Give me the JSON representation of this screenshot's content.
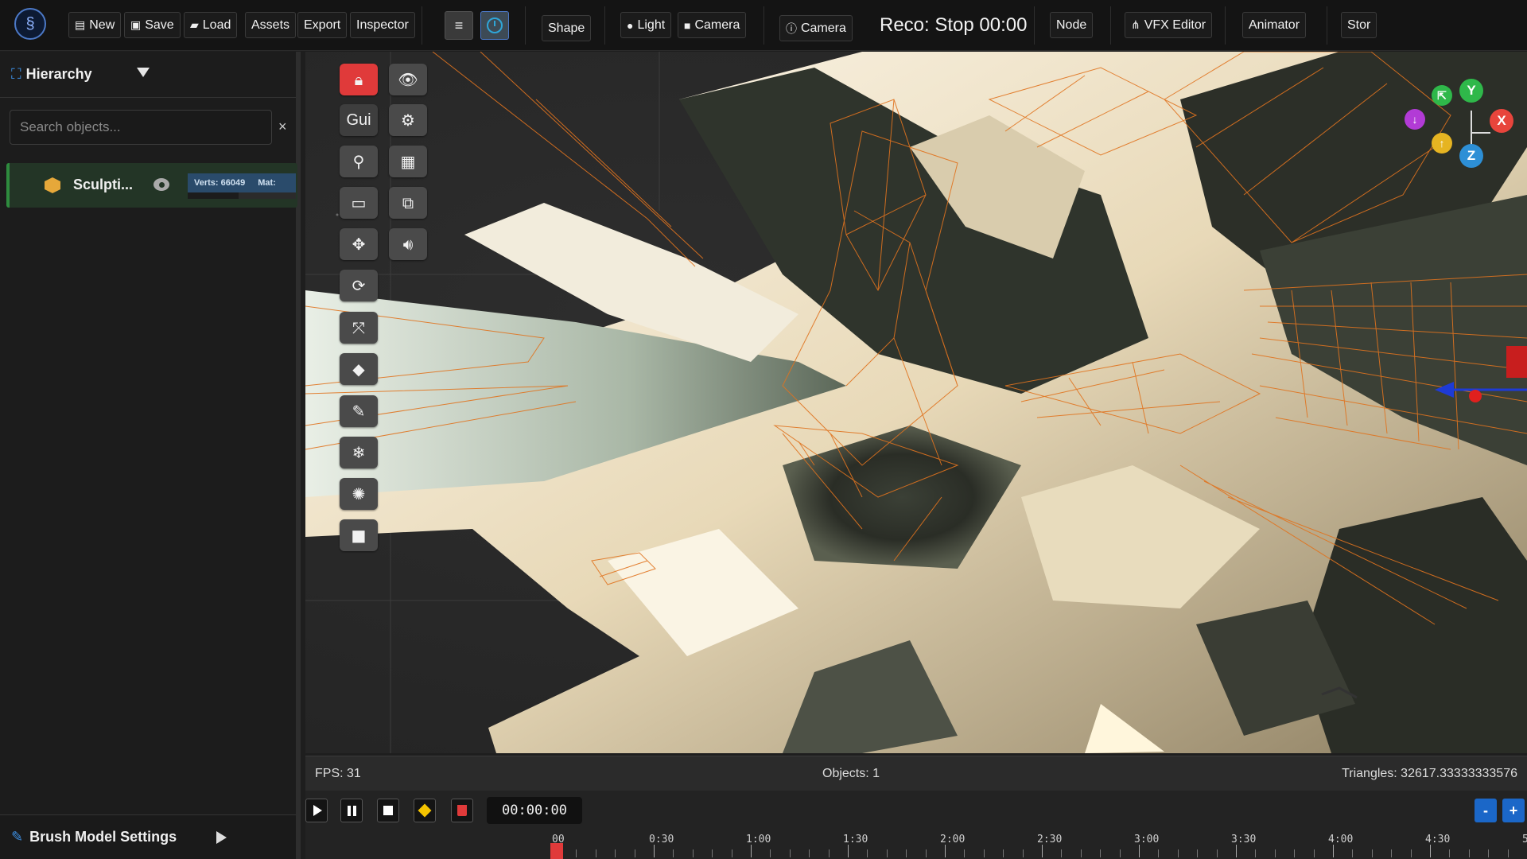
{
  "topbar": {
    "new_label": "New",
    "save_label": "Save",
    "load_label": "Load",
    "assets_label": "Assets",
    "export_label": "Export",
    "inspector_label": "Inspector",
    "shape_label": "Shape",
    "light_label": "Light",
    "camera_label": "Camera",
    "camera2_label": "Camera",
    "reco_status": "Reco: Stop 00:00",
    "node_label": "Node",
    "vfx_label": "VFX Editor",
    "animator_label": "Animator",
    "store_label": "Stor"
  },
  "hierarchy": {
    "title": "Hierarchy",
    "search_placeholder": "Search objects...",
    "clear_glyph": "×",
    "objects": [
      {
        "name": "Sculpti...",
        "verts": "Verts: 66049",
        "mat": "Mat:"
      }
    ]
  },
  "brush": {
    "title": "Brush Model Settings"
  },
  "toolbar": {
    "gui_label": "Gui"
  },
  "gizmo": {
    "y_label": "Y",
    "x_label": "X",
    "z_label": "Z",
    "colors": {
      "y": "#2fb84a",
      "x": "#e8453c",
      "z": "#2d8fd6",
      "extra_up": "#e6b422",
      "extra_down": "#b23bd6"
    }
  },
  "status": {
    "fps": "FPS: 31",
    "objects": "Objects: 1",
    "triangles": "Triangles: 32617.33333333576"
  },
  "timeline": {
    "timecode": "00:00:00",
    "zoom_out": "-",
    "zoom_in": "+",
    "ruler_labels": [
      "00",
      "0:30",
      "1:00",
      "1:30",
      "2:00",
      "2:30",
      "3:00",
      "3:30",
      "4:00",
      "4:30",
      "5:"
    ]
  },
  "colors": {
    "accent": "#4c79c7",
    "wireframe": "#e0731f",
    "selected_row": "#233526",
    "danger": "#e03a3a"
  }
}
